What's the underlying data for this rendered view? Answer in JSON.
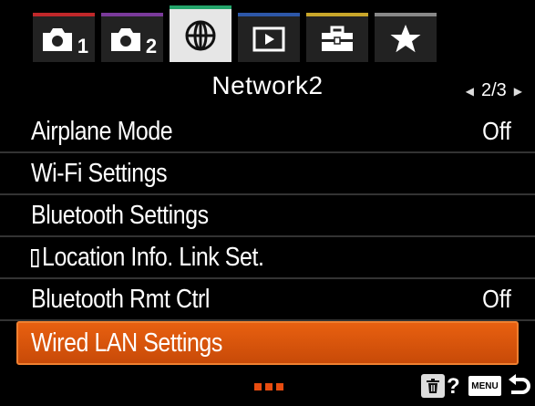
{
  "tabs": [
    {
      "id": "camera1",
      "icon": "camera-icon",
      "sub": "1"
    },
    {
      "id": "camera2",
      "icon": "camera-icon",
      "sub": "2"
    },
    {
      "id": "network",
      "icon": "globe-icon",
      "active": true
    },
    {
      "id": "playback",
      "icon": "playback-icon"
    },
    {
      "id": "setup",
      "icon": "toolbox-icon"
    },
    {
      "id": "my-menu",
      "icon": "star-icon"
    }
  ],
  "header": {
    "title": "Network2",
    "page": "2/3"
  },
  "menu": [
    {
      "label": "Airplane Mode",
      "value": "Off"
    },
    {
      "label": "Wi-Fi Settings",
      "value": ""
    },
    {
      "label": "Bluetooth Settings",
      "value": ""
    },
    {
      "label": "Location Info. Link Set.",
      "value": ""
    },
    {
      "label": "Bluetooth Rmt Ctrl",
      "value": "Off"
    },
    {
      "label": "Wired LAN Settings",
      "value": "",
      "selected": true
    }
  ],
  "footer": {
    "page_dots": [
      "#e84c10",
      "#e84c10",
      "#e84c10"
    ],
    "help": "?",
    "menu_key": "MENU",
    "icons": [
      "trash-icon",
      "help-icon",
      "menu-key-icon",
      "back-icon"
    ]
  },
  "colors": {
    "accent": "#e05a0c",
    "network_tab": "#23a36a",
    "background": "#000000"
  }
}
